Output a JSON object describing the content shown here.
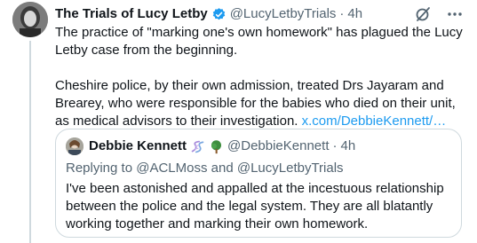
{
  "tweet": {
    "author_name": "The Trials of Lucy Letby",
    "handle": "@LucyLetbyTrials",
    "separator": "·",
    "time": "4h",
    "paragraphs": [
      "The practice of \"marking one's own homework\" has plagued the Lucy Letby case from the beginning.",
      "Cheshire police, by their own admission, treated Drs Jayaram and Brearey, who were responsible for the babies who died on their unit, as medical advisors to their investigation."
    ],
    "link_text": "x.com/DebbieKennett/…",
    "icons": {
      "verified": "verified-badge-icon",
      "grok": "grok-icon",
      "more": "more-icon"
    },
    "colors": {
      "accent": "#1d9bf0",
      "secondary_text": "#536471",
      "border": "#cfd9de"
    }
  },
  "quote": {
    "author_name": "Debbie Kennett",
    "handle": "@DebbieKennett",
    "separator": "·",
    "time": "4h",
    "emojis": [
      "dna-icon",
      "tree-icon"
    ],
    "reply_prefix": "Replying to",
    "reply_users": [
      "@ACLMoss",
      "@LucyLetbyTrials"
    ],
    "reply_joiner": "and",
    "body": "I've been astonished and appalled at the incestuous relationship between the police and the legal system. They are all blatantly working together and marking their own homework."
  }
}
